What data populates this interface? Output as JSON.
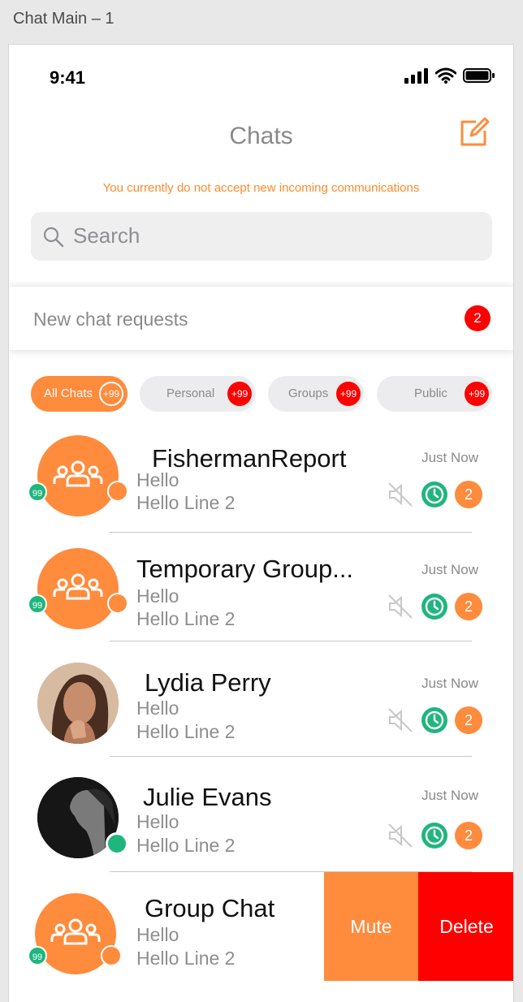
{
  "artboard": {
    "label": "Chat Main – 1"
  },
  "status_bar": {
    "time": "9:41"
  },
  "header": {
    "title": "Chats",
    "notice": "You currently do not accept new incoming communications"
  },
  "search": {
    "placeholder": "Search"
  },
  "requests": {
    "label": "New chat requests",
    "count": "2"
  },
  "filters": [
    {
      "label": "All Chats",
      "count": "+99",
      "active": true
    },
    {
      "label": "Personal",
      "count": "+99",
      "active": false
    },
    {
      "label": "Groups",
      "count": "+99",
      "active": false
    },
    {
      "label": "Public",
      "count": "+99",
      "active": false
    }
  ],
  "chats": [
    {
      "name": "FishermanReport",
      "line1": "Hello",
      "line2": "Hello Line 2",
      "time": "Just Now",
      "unread": "2",
      "member_count": "99",
      "avatar": "group"
    },
    {
      "name": "Temporary Group...",
      "line1": "Hello",
      "line2": "Hello Line 2",
      "time": "Just Now",
      "unread": "2",
      "member_count": "99",
      "avatar": "group"
    },
    {
      "name": "Lydia Perry",
      "line1": "Hello",
      "line2": "Hello Line 2",
      "time": "Just Now",
      "unread": "2",
      "avatar": "photo"
    },
    {
      "name": "Julie Evans",
      "line1": "Hello",
      "line2": "Hello Line 2",
      "time": "Just Now",
      "unread": "2",
      "avatar": "photo",
      "online": true
    },
    {
      "name": "Group Chat",
      "line1": "Hello",
      "line2": "Hello Line 2",
      "member_count": "99",
      "avatar": "group"
    }
  ],
  "swipe_actions": {
    "mute_label": "Mute",
    "delete_label": "Delete"
  },
  "colors": {
    "accent": "#ff8b3d",
    "danger": "#ff0000",
    "success": "#1fb67e"
  }
}
